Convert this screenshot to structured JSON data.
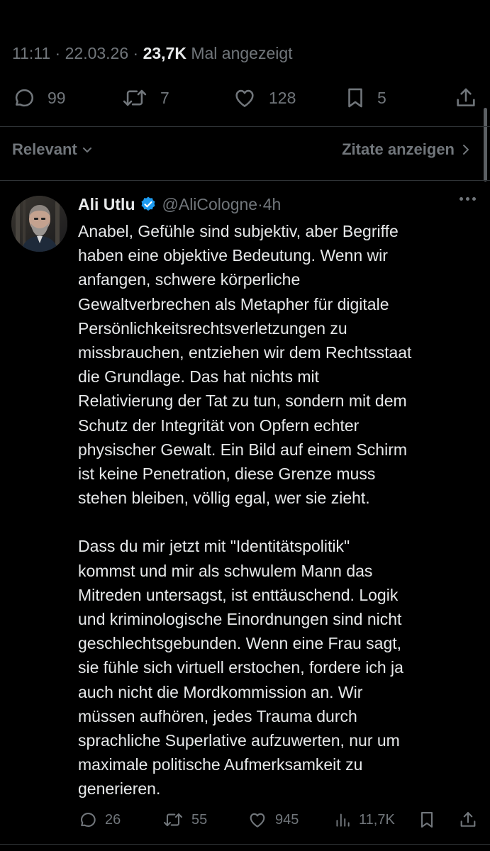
{
  "main_tweet": {
    "time": "11:11",
    "separator": "·",
    "date": "22.03.26",
    "views_count": "23,7K",
    "views_label": "Mal angezeigt",
    "actions": {
      "replies": "99",
      "reposts": "7",
      "likes": "128",
      "bookmarks": "5"
    }
  },
  "sort": {
    "relevant_label": "Relevant",
    "quotes_label": "Zitate anzeigen"
  },
  "reply": {
    "name": "Ali Utlu",
    "verified": true,
    "handle": "@AliCologne",
    "separator": "·",
    "time": "4h",
    "paragraph1": "Anabel, Gefühle sind subjektiv, aber Begriffe\nhaben eine objektive Bedeutung. Wenn wir\nanfangen, schwere körperliche\nGewaltverbrechen als Metapher für digitale\nPersönlichkeitsrechtsverletzungen zu\nmissbrauchen, entziehen wir dem Rechtsstaat\ndie Grundlage. Das hat nichts mit\nRelativierung der Tat zu tun, sondern mit dem\nSchutz der Integrität von Opfern echter\nphysischer Gewalt. Ein Bild auf einem Schirm\nist keine Penetration, diese Grenze muss\nstehen bleiben, völlig egal, wer sie zieht.",
    "paragraph2": "Dass du mir jetzt mit \"Identitätspolitik\"\nkommst und mir als schwulem Mann das\nMitreden untersagst, ist enttäuschend. Logik\nund kriminologische Einordnungen sind nicht\ngeschlechtsgebunden. Wenn eine Frau sagt,\nsie fühle sich virtuell erstochen, fordere ich ja\nauch nicht die Mordkommission an. Wir\nmüssen aufhören, jedes Trauma durch\nsprachliche Superlative aufzuwerten, nur um\nmaximale politische Aufmerksamkeit zu\ngenerieren.",
    "actions": {
      "replies": "26",
      "reposts": "55",
      "likes": "945",
      "views": "11,7K"
    }
  },
  "colors": {
    "background": "#000000",
    "text": "#e7e9ea",
    "muted": "#71767b",
    "verified": "#1d9bf0",
    "divider": "#2f3336"
  },
  "icons": [
    "comment-icon",
    "repost-icon",
    "heart-icon",
    "bookmark-icon",
    "share-icon",
    "chevron-down-icon",
    "chevron-right-icon",
    "verified-badge-icon",
    "more-icon",
    "views-icon"
  ]
}
